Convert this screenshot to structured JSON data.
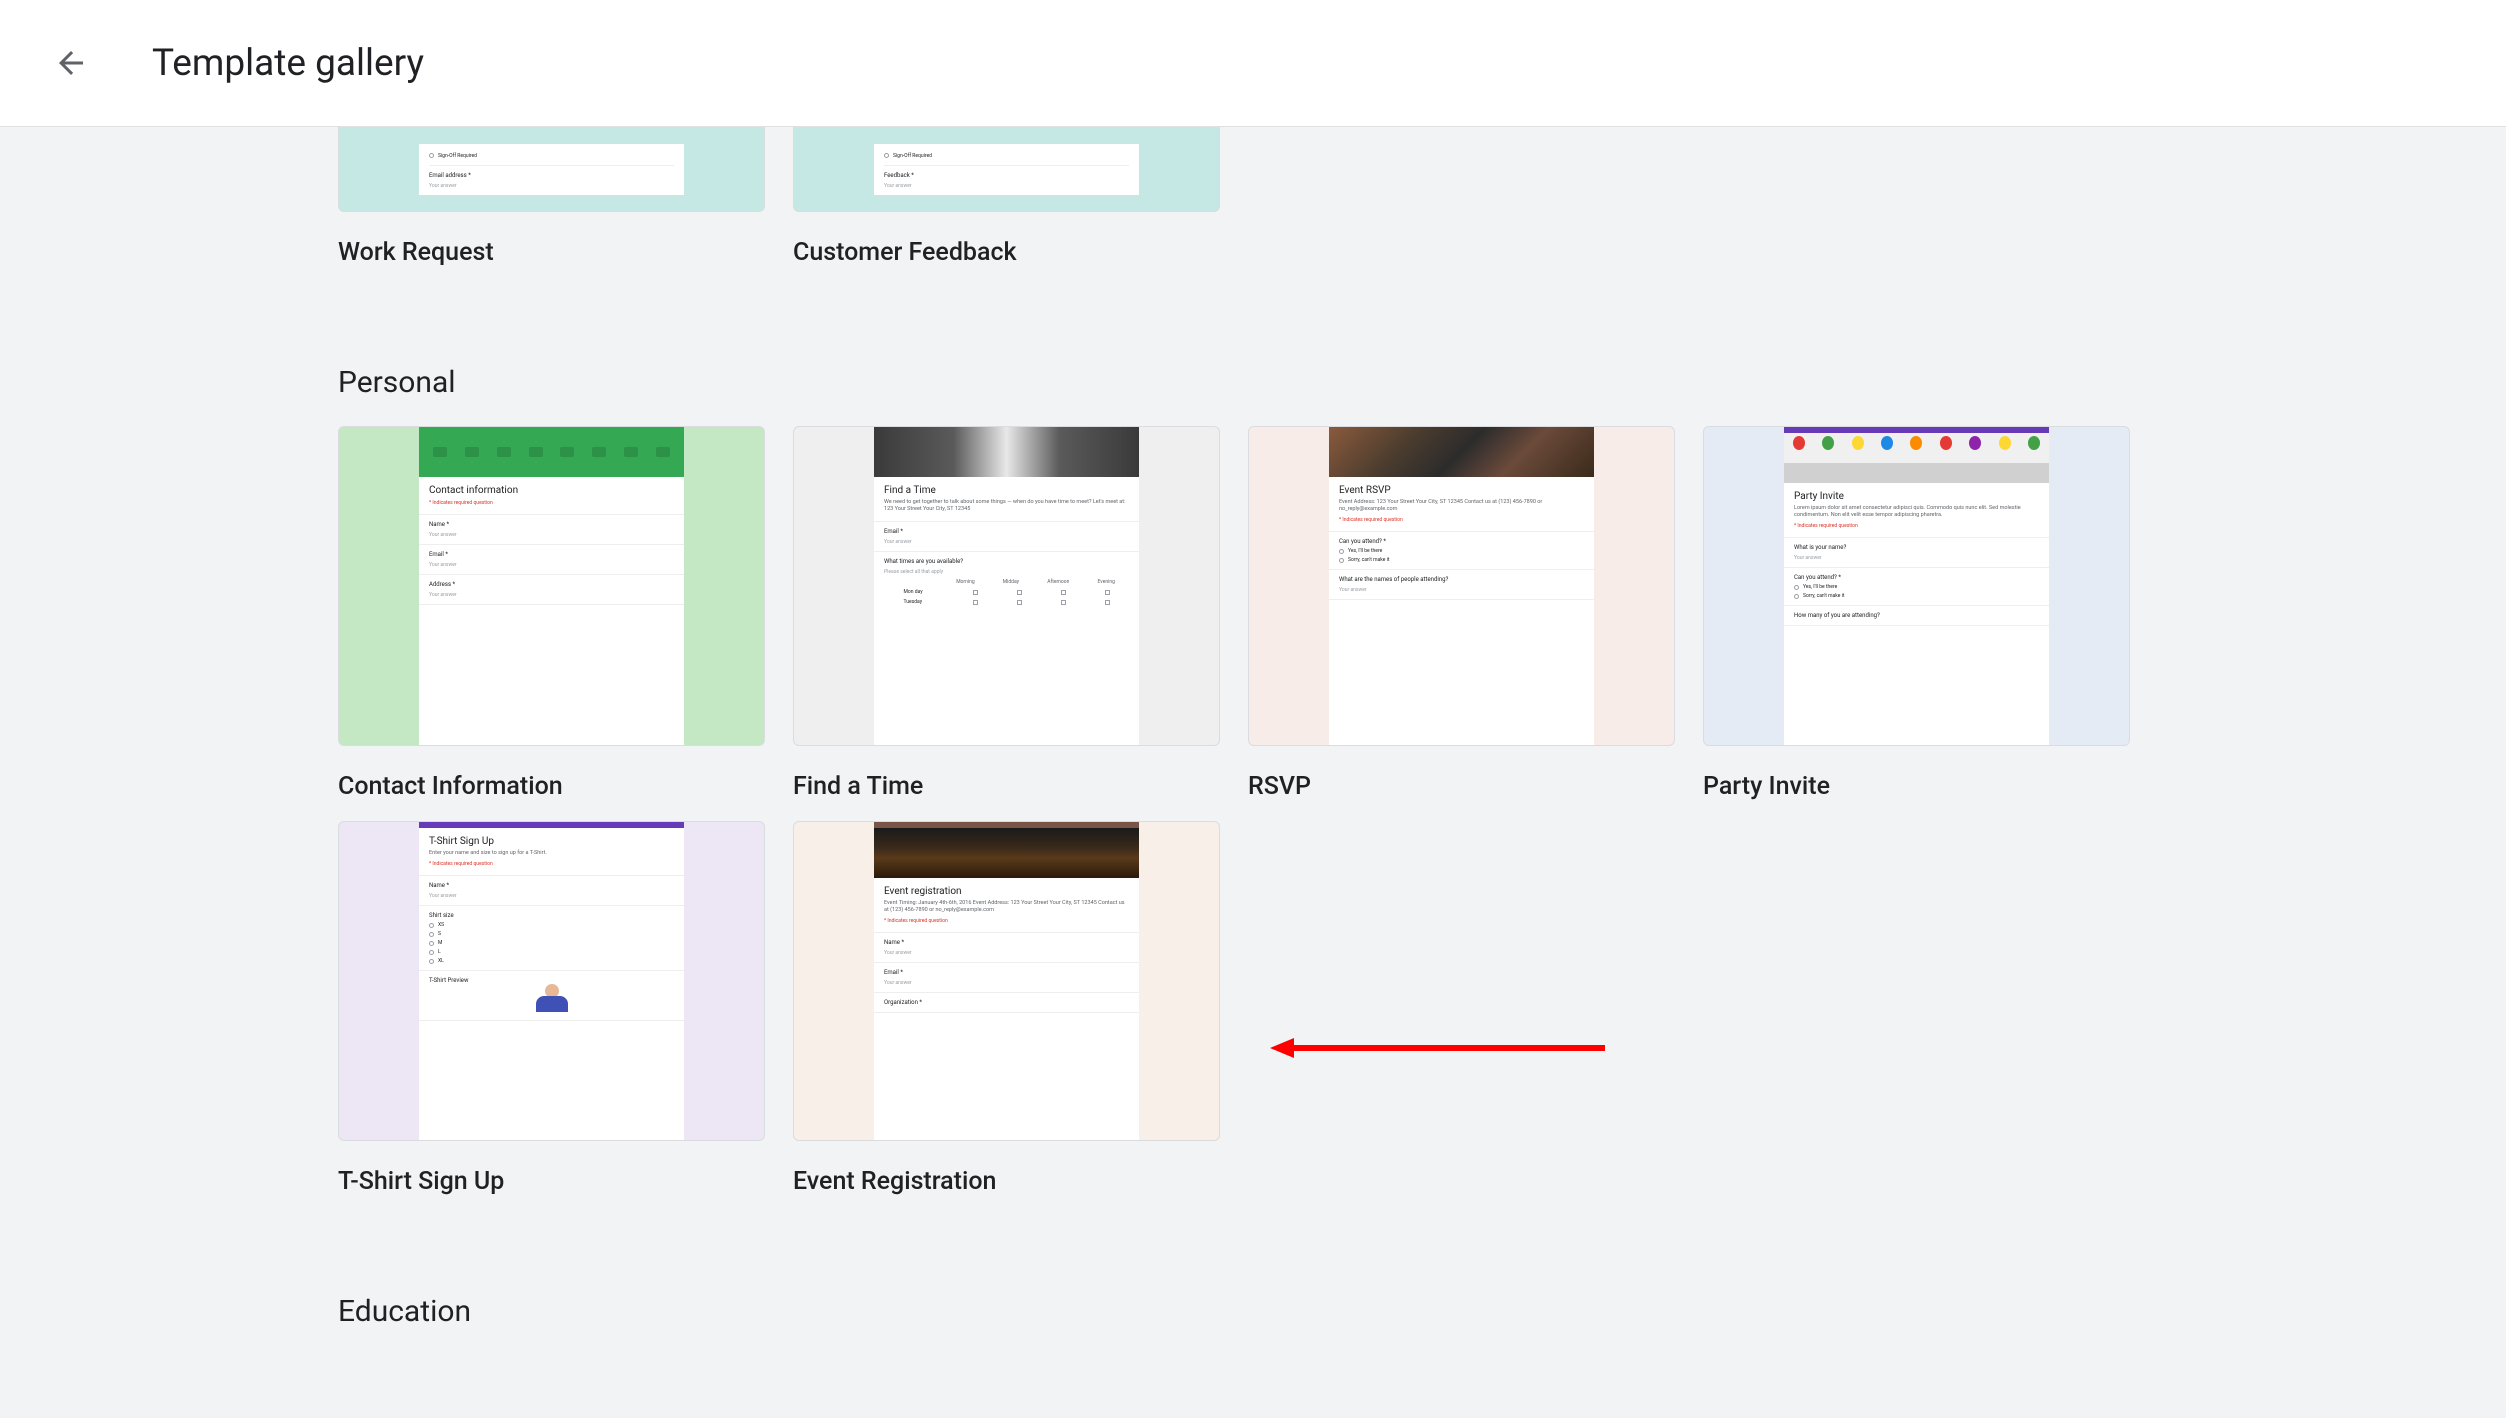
{
  "header": {
    "title": "Template gallery"
  },
  "partial_templates": [
    {
      "label": "Work Request",
      "field1_label": "Sign-Off Required",
      "field2_label": "Email address *",
      "answer_text": "Your answer"
    },
    {
      "label": "Customer Feedback",
      "field1_label": "Sign-Off Required",
      "field2_label": "Feedback *",
      "answer_text": "Your answer"
    }
  ],
  "sections": [
    {
      "title": "Personal",
      "templates": [
        {
          "label": "Contact Information",
          "bg": "bg-green",
          "header_type": "green",
          "title": "Contact information",
          "required": "* Indicates required question",
          "fields": [
            {
              "label": "Name *",
              "answer": "Your answer"
            },
            {
              "label": "Email *",
              "answer": "Your answer"
            },
            {
              "label": "Address *",
              "answer": "Your answer"
            }
          ]
        },
        {
          "label": "Find a Time",
          "bg": "bg-gray",
          "header_type": "book",
          "title": "Find a Time",
          "subtitle": "We need to get together to talk about some things — when do you have time to meet?\nLet's meet at: 123 Your Street Your City, ST 12345",
          "fields": [
            {
              "label": "Email *",
              "answer": "Your answer"
            }
          ],
          "grid_label": "What times are you available?",
          "grid_sub": "Please select all that apply",
          "grid_cols": [
            "Morning",
            "Midday",
            "Afternoon",
            "Evening"
          ],
          "grid_rows": [
            "Mon day",
            "Tuesday"
          ]
        },
        {
          "label": "RSVP",
          "bg": "bg-pink",
          "header_type": "people",
          "title": "Event RSVP",
          "subtitle": "Event Address: 123 Your Street Your City, ST 12345\nContact us at (123) 456-7890 or no_reply@example.com",
          "required": "* Indicates required question",
          "q1_label": "Can you attend? *",
          "q1_opt1": "Yes, I'll be there",
          "q1_opt2": "Sorry, can't make it",
          "q2_label": "What are the names of people attending?",
          "q2_answer": "Your answer"
        },
        {
          "label": "Party Invite",
          "bg": "bg-lightblue",
          "header_type": "balloons",
          "title": "Party Invite",
          "subtitle": "Lorem ipsum dolor sit amet consectetur adipisci quis. Commodo quis nunc elit. Sed\nmolestie condimentum. Non elit velit esse tempor adipiscing pharetra.",
          "required": "* Indicates required question",
          "q1_label": "What is your name?",
          "q1_answer": "Your answer",
          "q2_label": "Can you attend? *",
          "q2_opt1": "Yes, I'll be there",
          "q2_opt2": "Sorry, can't make it",
          "q3_label": "How many of you are attending?"
        },
        {
          "label": "T-Shirt Sign Up",
          "bg": "bg-lavender",
          "header_type": "purple",
          "title": "T-Shirt Sign Up",
          "subtitle": "Enter your name and size to sign up for a T-Shirt.",
          "required": "* Indicates required question",
          "fields": [
            {
              "label": "Name *",
              "answer": "Your answer"
            }
          ],
          "size_label": "Shirt size",
          "size_opts": [
            "XS",
            "S",
            "M",
            "L",
            "XL"
          ],
          "preview_label": "T-Shirt Preview"
        },
        {
          "label": "Event Registration",
          "bg": "bg-peach",
          "header_type": "building",
          "title": "Event registration",
          "subtitle": "Event Timing: January 4th-6th, 2016\nEvent Address: 123 Your Street Your City, ST 12345\nContact us at (123) 456-7890 or no_reply@example.com",
          "required": "* Indicates required question",
          "fields": [
            {
              "label": "Name *",
              "answer": "Your answer"
            },
            {
              "label": "Email *",
              "answer": "Your answer"
            },
            {
              "label": "Organization *",
              "answer": ""
            }
          ]
        }
      ]
    },
    {
      "title": "Education",
      "templates": []
    }
  ]
}
